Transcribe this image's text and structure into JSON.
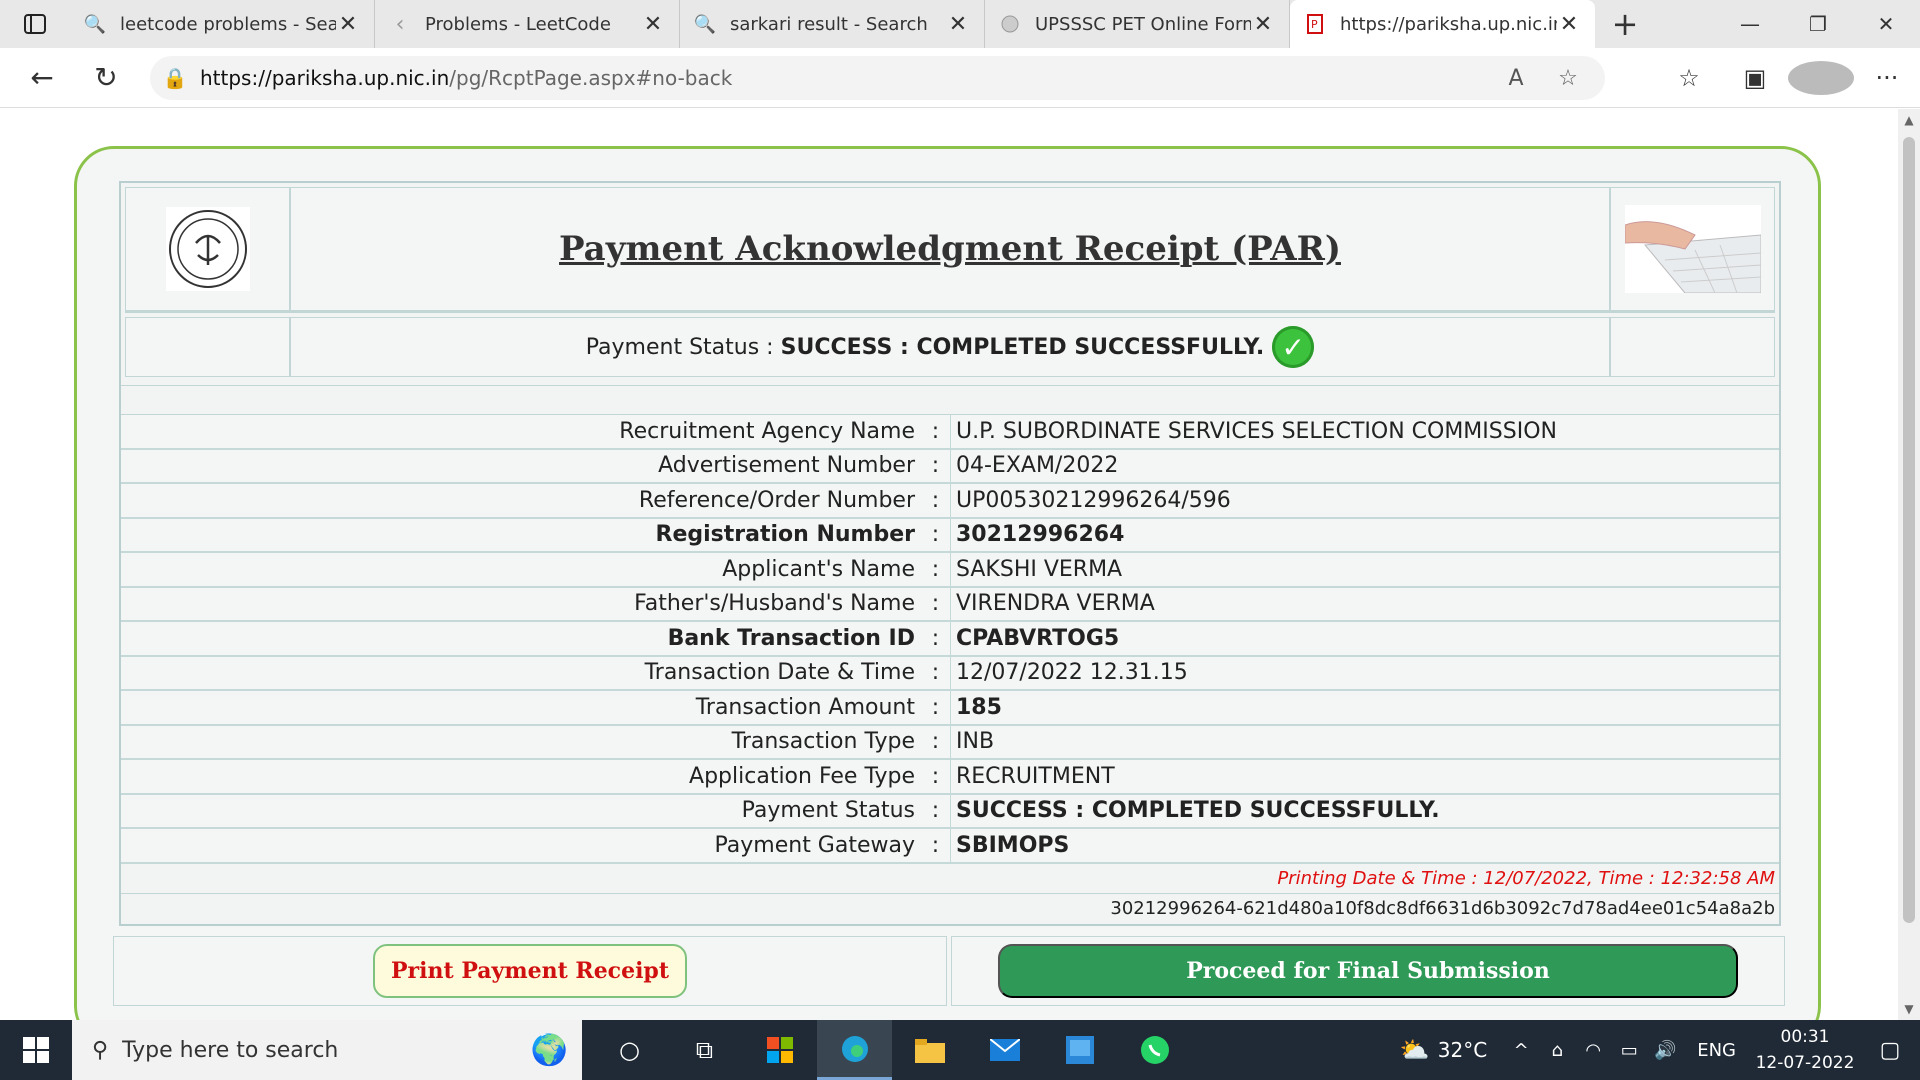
{
  "browser": {
    "tabs": [
      {
        "title": "leetcode problems - Searc",
        "icon": "search-icon"
      },
      {
        "title": "Problems - LeetCode",
        "icon": "leetcode-icon"
      },
      {
        "title": "sarkari result - Search",
        "icon": "search-icon"
      },
      {
        "title": "UPSSSC PET Online Form",
        "icon": "site-icon"
      },
      {
        "title": "https://pariksha.up.nic.in/p",
        "icon": "pariksha-icon"
      }
    ],
    "url_host": "https://pariksha.up.nic.in",
    "url_path": "/pg/RcptPage.aspx#no-back"
  },
  "receipt": {
    "title": "Payment Acknowledgment Receipt (PAR)",
    "status_label": "Payment Status :",
    "status_value": "SUCCESS : COMPLETED SUCCESSFULLY.",
    "rows": [
      {
        "label": "Recruitment Agency Name",
        "value": "U.P. SUBORDINATE SERVICES SELECTION COMMISSION"
      },
      {
        "label": "Advertisement Number",
        "value": "04-EXAM/2022"
      },
      {
        "label": "Reference/Order Number",
        "value": "UP00530212996264/596"
      },
      {
        "label": "Registration Number",
        "value": "30212996264"
      },
      {
        "label": "Applicant's Name",
        "value": "SAKSHI VERMA"
      },
      {
        "label": "Father's/Husband's Name",
        "value": "VIRENDRA VERMA"
      },
      {
        "label": "Bank Transaction ID",
        "value": "CPABVRTOG5"
      },
      {
        "label": "Transaction Date & Time",
        "value": "12/07/2022 12.31.15"
      },
      {
        "label": "Transaction Amount",
        "value": "185"
      },
      {
        "label": "Transaction Type",
        "value": "INB"
      },
      {
        "label": "Application Fee Type",
        "value": "RECRUITMENT"
      },
      {
        "label": "Payment Status",
        "value": "SUCCESS : COMPLETED SUCCESSFULLY."
      },
      {
        "label": "Payment Gateway",
        "value": "SBIMOPS"
      }
    ],
    "separator": ":",
    "printing_date": "Printing Date & Time : 12/07/2022, Time : 12:32:58 AM",
    "hash": "30212996264-621d480a10f8dc8df6631d6b3092c7d78ad4ee01c54a8a2b",
    "print_button": "Print Payment Receipt",
    "proceed_button": "Proceed for Final Submission"
  },
  "taskbar": {
    "search_placeholder": "Type here to search",
    "temperature": "32°C",
    "language": "ENG",
    "time": "00:31",
    "date": "12-07-2022"
  }
}
